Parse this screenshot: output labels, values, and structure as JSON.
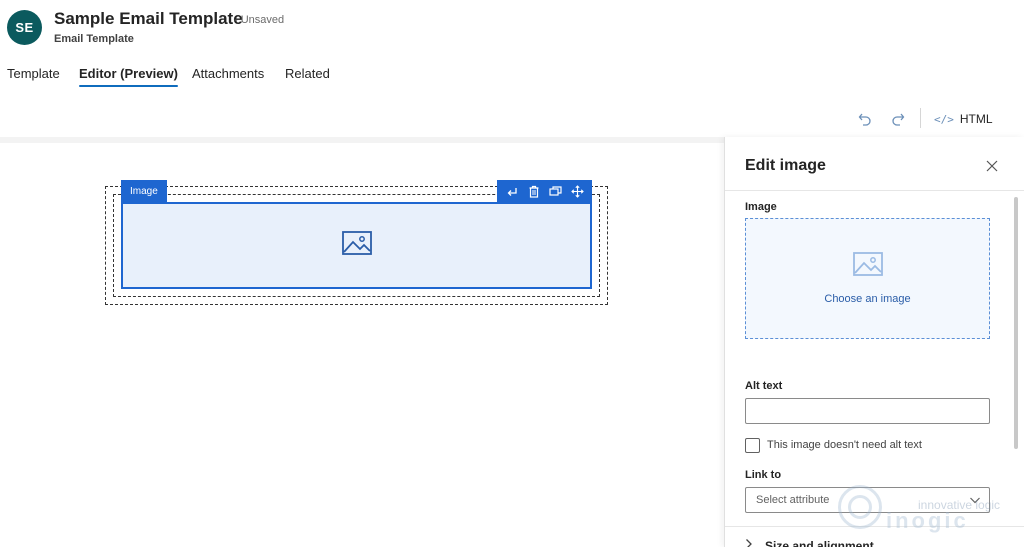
{
  "header": {
    "avatar_initials": "SE",
    "title": "Sample Email Template",
    "status": "- Unsaved",
    "subtitle": "Email Template"
  },
  "tabs": [
    {
      "label": "Template",
      "active": false
    },
    {
      "label": "Editor (Preview)",
      "active": true
    },
    {
      "label": "Attachments",
      "active": false
    },
    {
      "label": "Related",
      "active": false
    }
  ],
  "toolbar": {
    "undo_icon": "undo-icon",
    "redo_icon": "redo-icon",
    "html_label": "HTML",
    "html_icon": "code-icon"
  },
  "canvas": {
    "block_label": "Image",
    "actions": [
      "enter-icon",
      "delete-icon",
      "duplicate-icon",
      "move-icon"
    ],
    "placeholder_icon": "image-icon"
  },
  "panel": {
    "title": "Edit image",
    "image_label": "Image",
    "choose_image": "Choose an image",
    "alt_text_label": "Alt text",
    "alt_text_value": "",
    "no_alt_checkbox_label": "This image doesn't need alt text",
    "no_alt_checked": false,
    "link_to_label": "Link to",
    "link_to_placeholder": "Select attribute",
    "size_section": "Size and alignment"
  },
  "watermark": {
    "top": "innovative logic",
    "bottom": "inogic"
  },
  "colors": {
    "accent": "#0f6cbd",
    "selection": "#1e66d0",
    "avatar_bg": "#0b5a5e"
  }
}
